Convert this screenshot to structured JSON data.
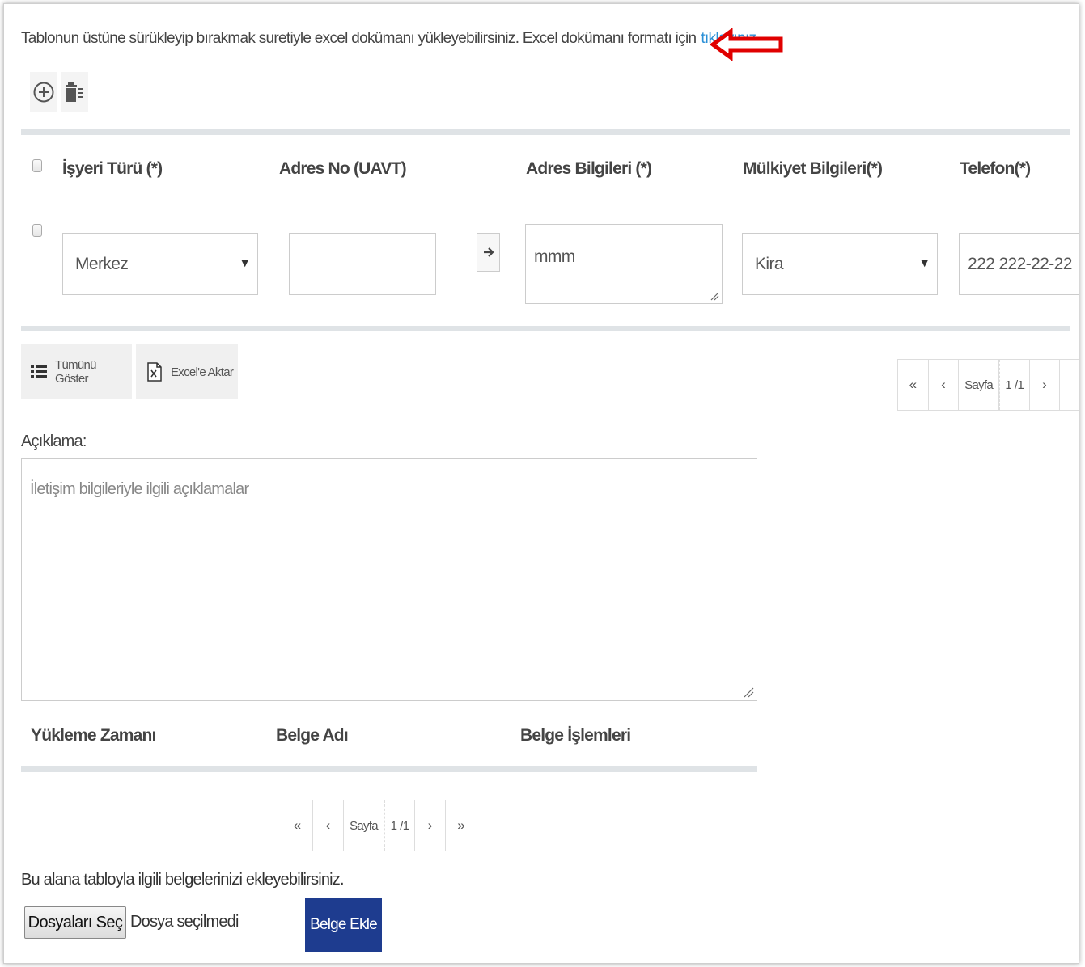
{
  "upload_hint": {
    "text": "Tablonun üstüne sürükleyip bırakmak suretiyle excel dokümanı yükleyebilirsiniz. Excel dokümanı formatı için",
    "link": "tıklayınız."
  },
  "toolbar": {
    "add_icon": "plus-circle-icon",
    "delete_icon": "trash-icon"
  },
  "table": {
    "columns": [
      "İşyeri Türü (*)",
      "Adres No (UAVT)",
      "Adres Bilgileri (*)",
      "Mülkiyet Bilgileri(*)",
      "Telefon(*)"
    ],
    "row": {
      "isyeri_turu": "Merkez",
      "adres_no": "",
      "adres_bilgileri": "mmm",
      "mulkiyet": "Kira",
      "telefon": "222 222-22-22"
    }
  },
  "actions": {
    "show_all": "Tümünü Göster",
    "export_excel": "Excel'e Aktar"
  },
  "pager_top": {
    "first": "«",
    "prev": "‹",
    "label": "Sayfa",
    "page": "1",
    "total": "/1",
    "next": "›"
  },
  "aciklama": {
    "label": "Açıklama:",
    "placeholder": "İletişim bilgileriyle ilgili açıklamalar"
  },
  "documents": {
    "columns": [
      "Yükleme Zamanı",
      "Belge Adı",
      "Belge İşlemleri"
    ],
    "pager": {
      "first": "«",
      "prev": "‹",
      "label": "Sayfa",
      "page": "1",
      "total": "/1",
      "next": "›",
      "last": "»"
    },
    "info": "Bu alana tabloyla ilgili belgelerinizi ekleyebilirsiniz.",
    "choose_button": "Dosyaları Seç",
    "no_file": "Dosya seçilmedi",
    "add_button": "Belge Ekle"
  },
  "colors": {
    "link": "#2a8fd6",
    "primary_button": "#1e3c8f",
    "annotation_arrow": "#e00000"
  }
}
